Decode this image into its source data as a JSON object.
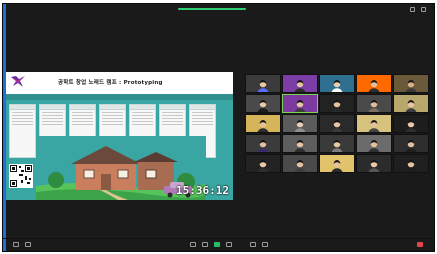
{
  "window": {
    "accent": "#1f6fd6",
    "top_left_label": "",
    "progress_color": "#2ecc71"
  },
  "share": {
    "title": "공학트 창업 노래드 캠프 : Prototyping",
    "band_text": "",
    "clock": "15:36:12",
    "teal": "#3aa6a3"
  },
  "gallery": {
    "center_name": "",
    "tiles": [
      {
        "name": "",
        "bg": "#3b3b3b",
        "skin": "#e8c9a6",
        "shirt": "#5a6cff"
      },
      {
        "name": "",
        "bg": "#7a3ea6",
        "skin": "#e6c39b",
        "shirt": "#2c2c2c"
      },
      {
        "name": "",
        "bg": "#2f6f8f",
        "skin": "#e9cfb1",
        "shirt": "#ffffff"
      },
      {
        "name": "",
        "bg": "#ff6a00",
        "skin": "#e7c09b",
        "shirt": "#2d2d2d"
      },
      {
        "name": "",
        "bg": "#6b5a3a",
        "skin": "#d8b08a",
        "shirt": "#3a3a3a"
      },
      {
        "name": "",
        "bg": "#4a4a4a",
        "skin": "#e8caa7",
        "shirt": "#1b1b1b"
      },
      {
        "name": "",
        "bg": "#7c3aa0",
        "skin": "#e7c5a3",
        "shirt": "#3c3c3c"
      },
      {
        "name": "",
        "bg": "#222222",
        "skin": "#e5c2a1",
        "shirt": "#2a2a2a"
      },
      {
        "name": "",
        "bg": "#4a4a4a",
        "skin": "#e1bc98",
        "shirt": "#7b6f5e"
      },
      {
        "name": "",
        "bg": "#b9a86b",
        "skin": "#e5c7a6",
        "shirt": "#3d3d3d"
      },
      {
        "name": "",
        "bg": "#d6b55a",
        "skin": "#e6c19c",
        "shirt": "#2d2d2d"
      },
      {
        "name": "",
        "bg": "#5b5b5b",
        "skin": "#e9cfb7",
        "shirt": "#8f8f8f"
      },
      {
        "name": "",
        "bg": "#2a2a2a",
        "skin": "#e6c4a4",
        "shirt": "#3b3b3b"
      },
      {
        "name": "",
        "bg": "#d7c27e",
        "skin": "#e6c1a0",
        "shirt": "#444444"
      },
      {
        "name": "",
        "bg": "#1d1d1d",
        "skin": "#e8c9aa",
        "shirt": "#2e2e2e"
      },
      {
        "name": "",
        "bg": "#3b3b3b",
        "skin": "#e3c1a0",
        "shirt": "#3a2b6a"
      },
      {
        "name": "",
        "bg": "#5d5d5d",
        "skin": "#e6c6a2",
        "shirt": "#2f2f2f"
      },
      {
        "name": "",
        "bg": "#3a3a3a",
        "skin": "#e8c9a8",
        "shirt": "#7c7c7c"
      },
      {
        "name": "",
        "bg": "#6b6b6b",
        "skin": "#e6c09b",
        "shirt": "#303030"
      },
      {
        "name": "",
        "bg": "#2e2e2e",
        "skin": "#e3c0a1",
        "shirt": "#1f1f1f"
      },
      {
        "name": "",
        "bg": "#232323",
        "skin": "#e7c7a5",
        "shirt": "#2d2d2d"
      },
      {
        "name": "",
        "bg": "#4b4b4b",
        "skin": "#e5c3a2",
        "shirt": "#3f3f3f"
      },
      {
        "name": "",
        "bg": "#e0c36b",
        "skin": "#e6c29e",
        "shirt": "#2b2b2b"
      },
      {
        "name": "",
        "bg": "#2b2b2b",
        "skin": "#e8caa6",
        "shirt": "#565656"
      },
      {
        "name": "",
        "bg": "#1f1f1f",
        "skin": "#e6c4a0",
        "shirt": "#1d1d1d"
      }
    ]
  },
  "toolbar": {
    "items": [
      "mute",
      "video",
      "security",
      "participants",
      "chat",
      "share-screen",
      "record",
      "reactions",
      "apps",
      "end"
    ]
  }
}
